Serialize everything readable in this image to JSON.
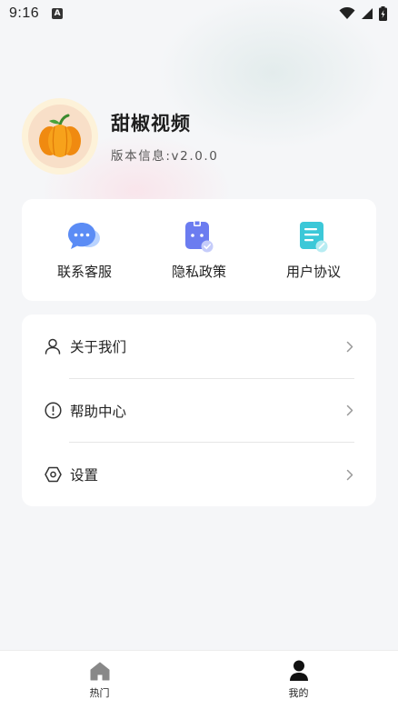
{
  "status_bar": {
    "time": "9:16",
    "notification_letter": "A"
  },
  "profile": {
    "app_name": "甜椒视频",
    "version": "版本信息:v2.0.0"
  },
  "quick_actions": [
    {
      "label": "联系客服",
      "icon": "chat-bubble-icon",
      "color": "#5b8cf5"
    },
    {
      "label": "隐私政策",
      "icon": "privacy-document-icon",
      "color": "#6b7cf0"
    },
    {
      "label": "用户协议",
      "icon": "agreement-document-icon",
      "color": "#3cc8d8"
    }
  ],
  "menu": [
    {
      "label": "关于我们",
      "icon": "user-icon"
    },
    {
      "label": "帮助中心",
      "icon": "help-exclamation-icon"
    },
    {
      "label": "设置",
      "icon": "settings-hexagon-icon"
    }
  ],
  "bottom_nav": [
    {
      "label": "热门",
      "icon": "home-icon",
      "active": false
    },
    {
      "label": "我的",
      "icon": "profile-icon",
      "active": true
    }
  ],
  "colors": {
    "background": "#f5f6f8",
    "card": "#ffffff",
    "text": "#222222",
    "inactive_icon": "#888888"
  }
}
